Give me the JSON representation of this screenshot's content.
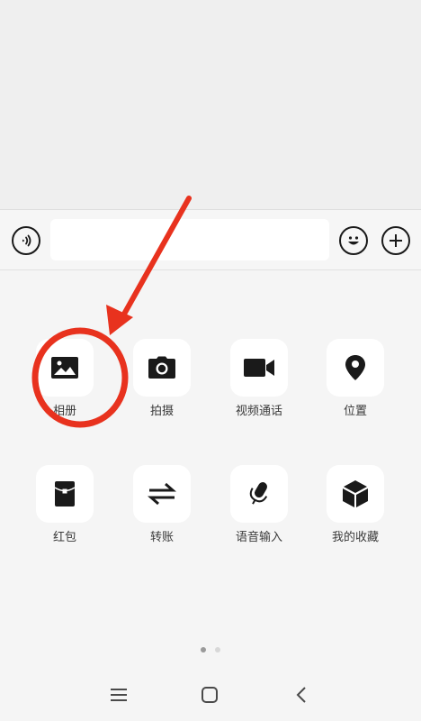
{
  "input_bar": {
    "text_value": "",
    "voice_icon": "voice-wave-icon",
    "emoji_icon": "smiley-icon",
    "plus_icon": "plus-icon"
  },
  "tools": [
    {
      "label": "相册",
      "icon": "photo-album-icon"
    },
    {
      "label": "拍摄",
      "icon": "camera-icon"
    },
    {
      "label": "视频通话",
      "icon": "video-camera-icon"
    },
    {
      "label": "位置",
      "icon": "location-pin-icon"
    },
    {
      "label": "红包",
      "icon": "red-packet-icon"
    },
    {
      "label": "转账",
      "icon": "transfer-arrows-icon"
    },
    {
      "label": "语音输入",
      "icon": "microphone-icon"
    },
    {
      "label": "我的收藏",
      "icon": "cube-favorites-icon"
    }
  ],
  "pager": {
    "pages": 2,
    "active": 1
  },
  "colors": {
    "annotation_red": "#e8321e",
    "icon_dark": "#1a1a1a",
    "label_text": "#3a3a3a"
  }
}
